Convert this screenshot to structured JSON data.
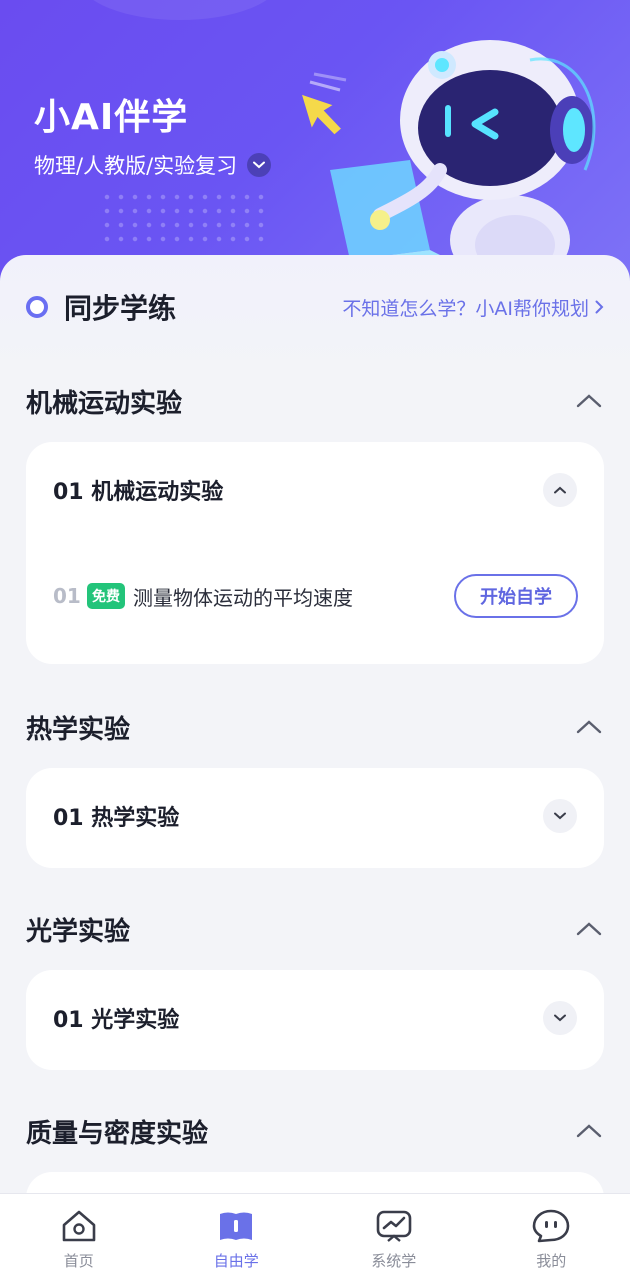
{
  "header": {
    "title": "小AI伴学",
    "subject": "物理/人教版/实验复习"
  },
  "sync": {
    "title": "同步学练",
    "plan_link": "不知道怎么学？小AI帮你规划"
  },
  "sections": [
    {
      "title": "机械运动实验",
      "card": {
        "title": "01 机械运动实验",
        "expanded": true,
        "lessons": [
          {
            "num": "01",
            "badge": "免费",
            "title": "测量物体运动的平均速度",
            "action": "开始自学"
          }
        ]
      }
    },
    {
      "title": "热学实验",
      "card": {
        "title": "01 热学实验",
        "expanded": false
      }
    },
    {
      "title": "光学实验",
      "card": {
        "title": "01 光学实验",
        "expanded": false
      }
    },
    {
      "title": "质量与密度实验"
    }
  ],
  "tabbar": {
    "items": [
      {
        "label": "首页",
        "icon": "home-icon",
        "active": false
      },
      {
        "label": "自由学",
        "icon": "book-icon",
        "active": true
      },
      {
        "label": "系统学",
        "icon": "chart-board-icon",
        "active": false
      },
      {
        "label": "我的",
        "icon": "chat-face-icon",
        "active": false
      }
    ]
  },
  "colors": {
    "header_gradient_start": "#6a4cf0",
    "accent": "#6a71e8",
    "free_badge": "#23c47a",
    "background": "#f3f4f8"
  }
}
